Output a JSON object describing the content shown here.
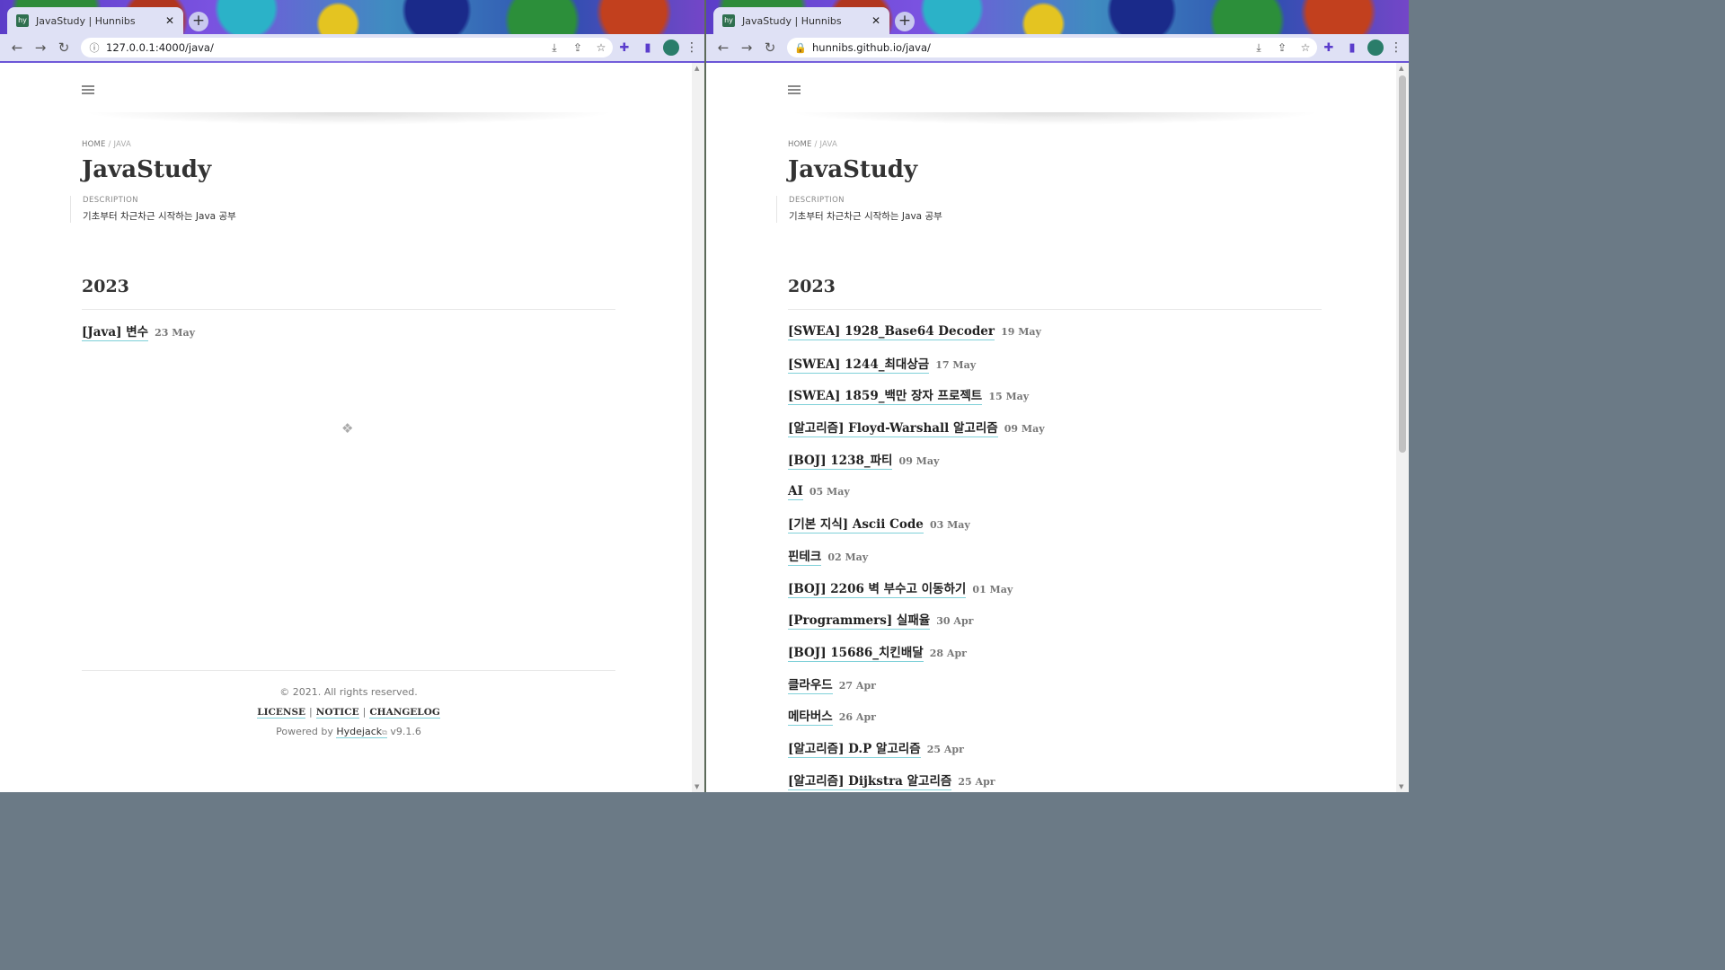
{
  "left": {
    "tab_title": "JavaStudy | Hunnibs",
    "url": "127.0.0.1:4000/java/",
    "breadcrumb": {
      "home": "HOME",
      "sep": "/",
      "current": "JAVA"
    },
    "title": "JavaStudy",
    "description_label": "DESCRIPTION",
    "description": "기초부터 차근차근 시작하는 Java 공부",
    "year": "2023",
    "posts": [
      {
        "title": "[Java] 변수",
        "date": "23 May"
      }
    ],
    "footer": {
      "copyright": "© 2021. All rights reserved.",
      "links": [
        "LICENSE",
        "NOTICE",
        "CHANGELOG"
      ],
      "link_sep": "|",
      "powered_prefix": "Powered by",
      "powered_name": "Hydejack",
      "version": "v9.1.6"
    }
  },
  "right": {
    "tab_title": "JavaStudy | Hunnibs",
    "url": "hunnibs.github.io/java/",
    "breadcrumb": {
      "home": "HOME",
      "sep": "/",
      "current": "JAVA"
    },
    "title": "JavaStudy",
    "description_label": "DESCRIPTION",
    "description": "기초부터 차근차근 시작하는 Java 공부",
    "year": "2023",
    "posts": [
      {
        "title": "[SWEA] 1928_Base64 Decoder",
        "date": "19 May"
      },
      {
        "title": "[SWEA] 1244_최대상금",
        "date": "17 May"
      },
      {
        "title": "[SWEA] 1859_백만 장자 프로젝트",
        "date": "15 May"
      },
      {
        "title": "[알고리즘] Floyd-Warshall 알고리즘",
        "date": "09 May"
      },
      {
        "title": "[BOJ] 1238_파티",
        "date": "09 May"
      },
      {
        "title": "AI",
        "date": "05 May"
      },
      {
        "title": "[기본 지식] Ascii Code",
        "date": "03 May"
      },
      {
        "title": "핀테크",
        "date": "02 May"
      },
      {
        "title": "[BOJ] 2206 벽 부수고 이동하기",
        "date": "01 May"
      },
      {
        "title": "[Programmers] 실패율",
        "date": "30 Apr"
      },
      {
        "title": "[BOJ] 15686_치킨배달",
        "date": "28 Apr"
      },
      {
        "title": "클라우드",
        "date": "27 Apr"
      },
      {
        "title": "메타버스",
        "date": "26 Apr"
      },
      {
        "title": "[알고리즘] D.P 알고리즘",
        "date": "25 Apr"
      },
      {
        "title": "[알고리즘] Dijkstra 알고리즘",
        "date": "25 Apr"
      }
    ]
  },
  "icons": {
    "favicon_text": "hy",
    "close": "✕",
    "new_tab": "+",
    "back": "←",
    "forward": "→",
    "reload": "↻",
    "info": "ⓘ",
    "lock": "🔒",
    "install": "⤓",
    "share": "⇪",
    "star": "☆",
    "extensions": "✚",
    "sidebar": "▮",
    "menu": "⋮",
    "loader": "❖",
    "external": "⧉"
  }
}
